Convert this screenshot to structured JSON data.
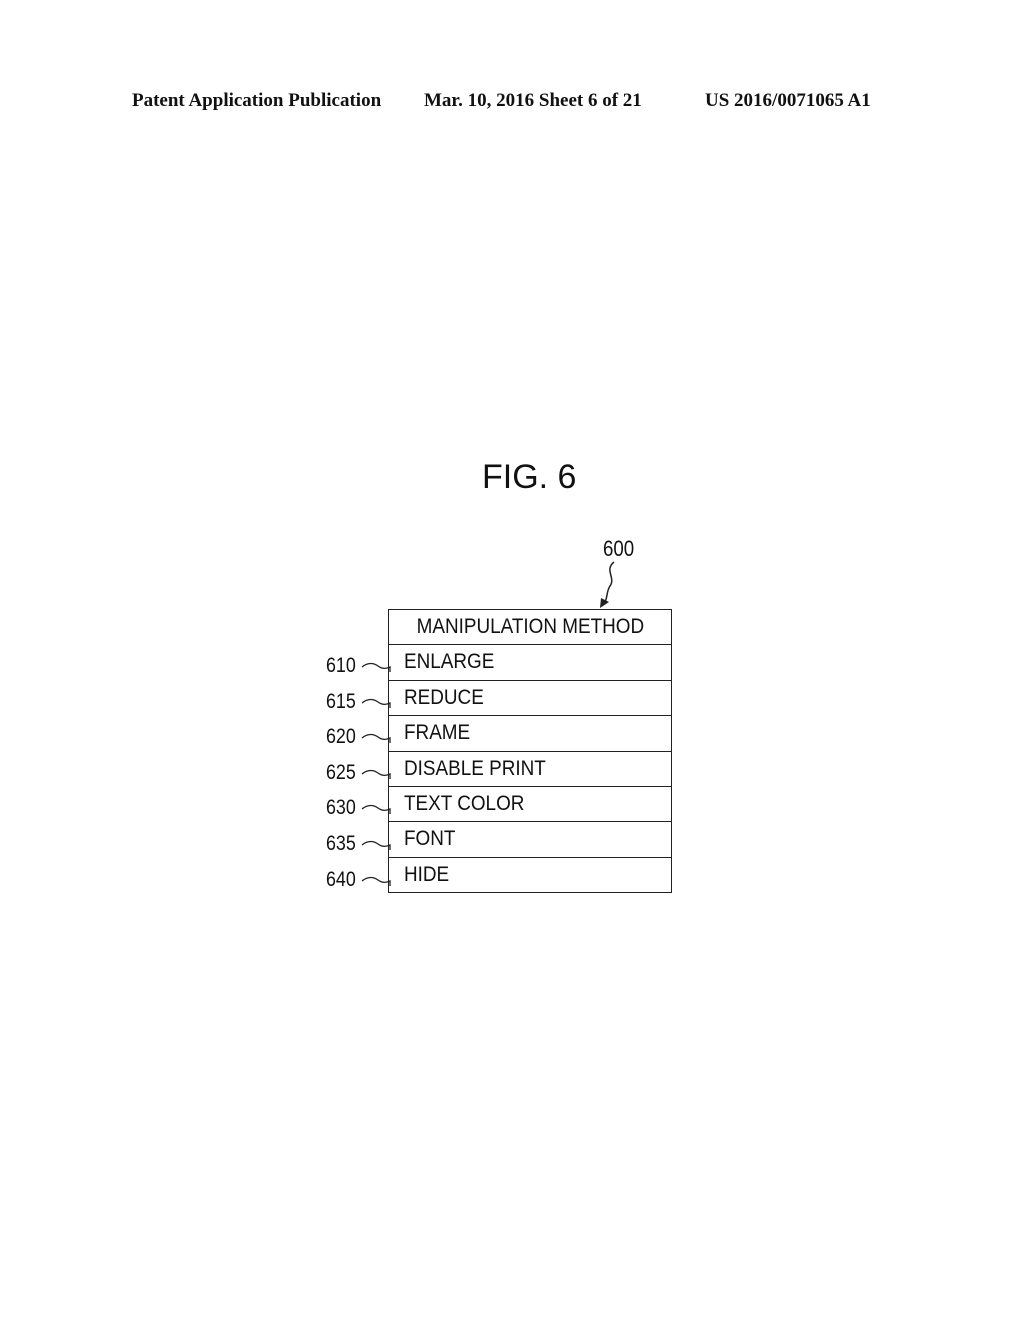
{
  "header": {
    "left": "Patent Application Publication",
    "middle": "Mar. 10, 2016  Sheet 6 of 21",
    "right": "US 2016/0071065 A1"
  },
  "figure": {
    "title": "FIG. 6",
    "table_ref": "600",
    "table_header": "MANIPULATION METHOD",
    "rows": [
      {
        "ref": "610",
        "label": "ENLARGE"
      },
      {
        "ref": "615",
        "label": "REDUCE"
      },
      {
        "ref": "620",
        "label": "FRAME"
      },
      {
        "ref": "625",
        "label": "DISABLE PRINT"
      },
      {
        "ref": "630",
        "label": "TEXT COLOR"
      },
      {
        "ref": "635",
        "label": "FONT"
      },
      {
        "ref": "640",
        "label": "HIDE"
      }
    ]
  }
}
